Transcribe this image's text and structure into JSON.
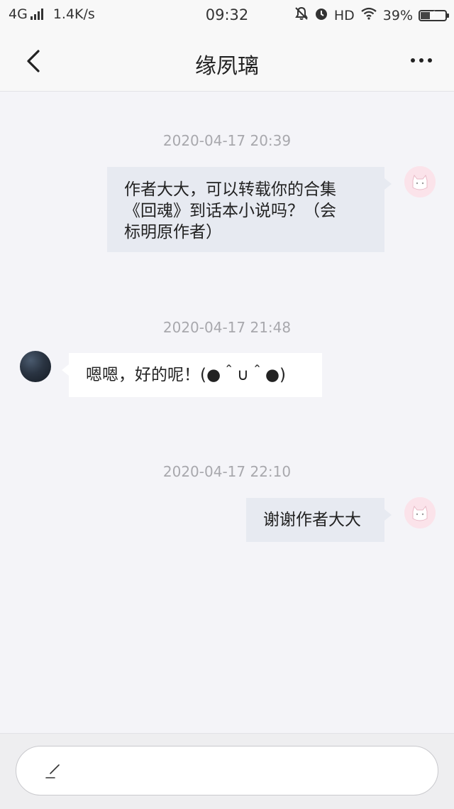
{
  "status_bar": {
    "network": "4G",
    "speed": "1.4K/s",
    "time": "09:32",
    "hd": "HD",
    "battery_percent": "39%",
    "battery_level": 0.39,
    "icons": [
      "signal-icon",
      "mute-bell-icon",
      "alarm-icon",
      "wifi-icon",
      "battery-icon"
    ]
  },
  "header": {
    "title": "缘夙璃",
    "back_icon": "chevron-left-icon",
    "more_icon": "more-icon"
  },
  "messages": [
    {
      "timestamp": "2020-04-17 20:39",
      "side": "self",
      "lines": [
        "作者大大，可以转载你的合集",
        "《回魂》到话本小说吗？（会",
        "标明原作者）"
      ]
    },
    {
      "timestamp": "2020-04-17 21:48",
      "side": "other",
      "text": "嗯嗯，好的呢！(●＾∪＾●)"
    },
    {
      "timestamp": "2020-04-17 22:10",
      "side": "self",
      "text": "谢谢作者大大"
    }
  ],
  "input": {
    "icon": "pen-icon",
    "placeholder": ""
  },
  "colors": {
    "background": "#f4f4f8",
    "self_bubble": "#e7eaf1",
    "other_bubble": "#ffffff",
    "timestamp": "#a8a8ad"
  }
}
